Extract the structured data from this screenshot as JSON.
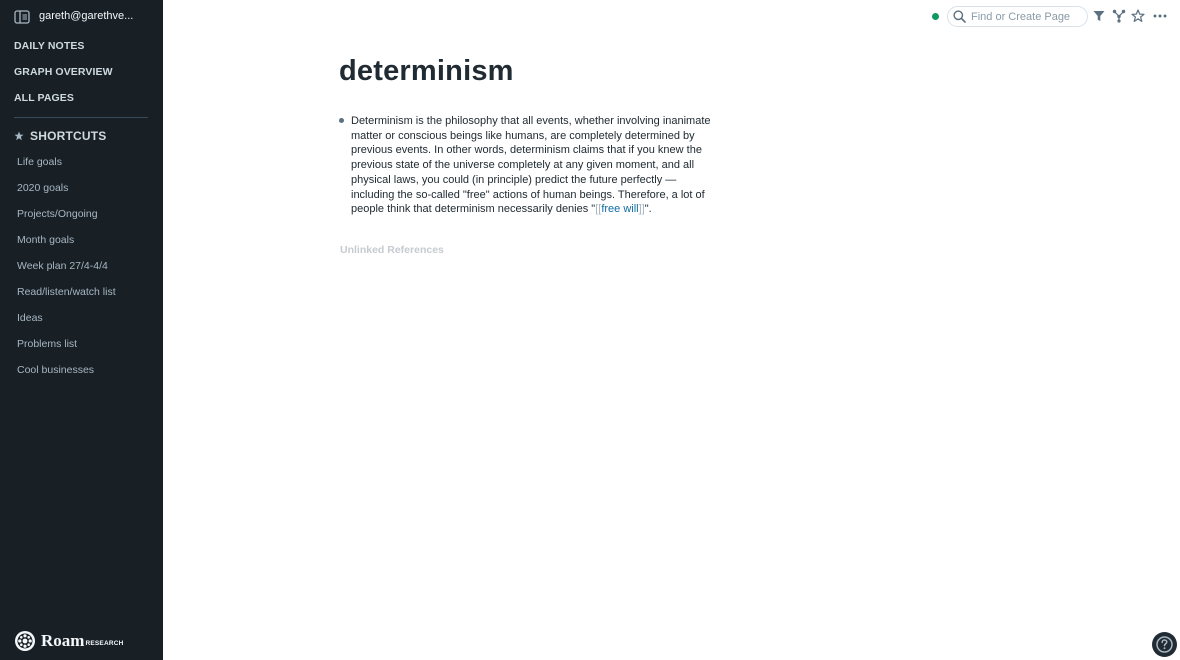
{
  "sidebar": {
    "user": "gareth@garethve...",
    "nav": [
      "DAILY NOTES",
      "GRAPH OVERVIEW",
      "ALL PAGES"
    ],
    "shortcuts_label": "SHORTCUTS",
    "shortcuts": [
      "Life goals",
      "2020 goals",
      "Projects/Ongoing",
      "Month goals",
      "Week plan 27/4-4/4",
      "Read/listen/watch list",
      "Ideas",
      "Problems list",
      "Cool businesses"
    ],
    "logo": {
      "name": "Roam",
      "sub": "RESEARCH"
    }
  },
  "topbar": {
    "search_placeholder": "Find or Create Page",
    "status_color": "#0f9960",
    "icons": [
      "filter-icon",
      "graph-icon",
      "star-icon",
      "more-icon"
    ]
  },
  "page": {
    "title": "determinism",
    "block": {
      "text": "Determinism is the philosophy that all events, whether involving inanimate matter or conscious beings like humans, are completely determined by previous events. In other words, determinism claims that if you knew the previous state of the universe completely at any given moment, and all physical laws, you could (in principle) predict the future perfectly —including the so-called \"free\" actions of human beings. Therefore, a lot of people think that determinism necessarily denies \"",
      "open_bracket": "[[",
      "link": "free will",
      "close_bracket": "]]",
      "tail": "\"."
    },
    "unlinked_references": "Unlinked References"
  },
  "colors": {
    "sidebar_bg": "#182026",
    "link": "#106ba3",
    "accent": "#0f9960"
  }
}
